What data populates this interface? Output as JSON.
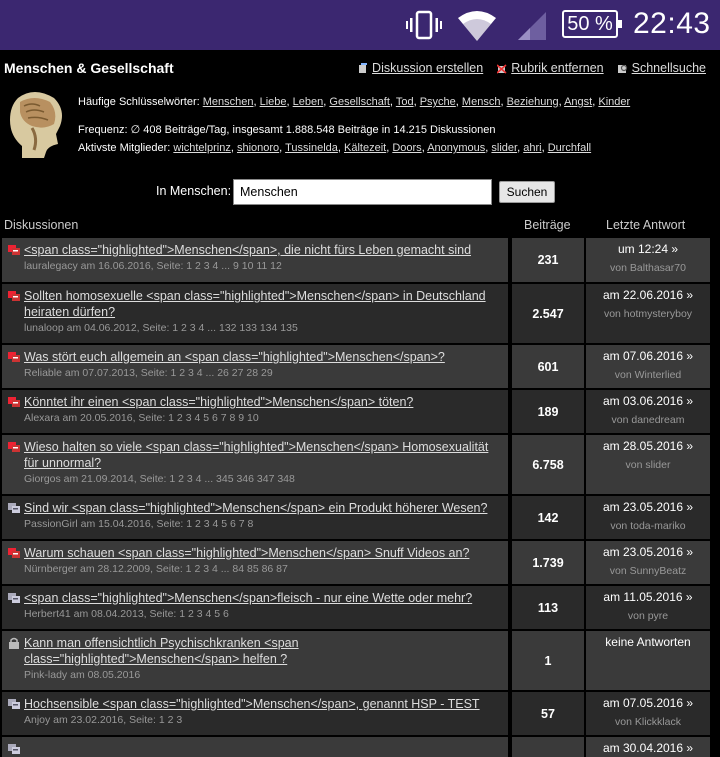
{
  "status_bar": {
    "battery": "50 %",
    "time": "22:43"
  },
  "header": {
    "title": "Menschen & Gesellschaft",
    "links": [
      "Diskussion erstellen",
      "Rubrik entfernen",
      "Schnellsuche"
    ]
  },
  "info": {
    "keywords_label": "Häufige Schlüsselwörter:",
    "keywords": [
      "Menschen",
      "Liebe",
      "Leben",
      "Gesellschaft",
      "Tod",
      "Psyche",
      "Mensch",
      "Beziehung",
      "Angst",
      "Kinder"
    ],
    "frequency": "Frequenz: ∅ 408 Beiträge/Tag, insgesamt 1.888.548 Beiträge in 14.215 Diskussionen",
    "members_label": "Aktivste Mitglieder:",
    "members": [
      "wichtelprinz",
      "shionoro",
      "Tussinelda",
      "Kältezeit",
      "Doors",
      "Anonymous",
      "slider",
      "ahri",
      "Durchfall"
    ]
  },
  "search": {
    "label": "In Menschen:",
    "value": "Menschen",
    "button": "Suchen"
  },
  "table": {
    "headers": [
      "Diskussionen",
      "Beiträge",
      "Letzte Antwort"
    ],
    "rows": [
      {
        "title": "<span class=\"highlighted\">Menschen</span>, die nicht fürs Leben gemacht sind",
        "meta": "lauralegacy am 16.06.2016, Seite: 1 2 3 4 ... 9 10 11 12",
        "count": "231",
        "last_date": "um 12:24 »",
        "last_by": "von Balthasar70",
        "icon": "hot-topic-icon"
      },
      {
        "title": "Sollten homosexuelle <span class=\"highlighted\">Menschen</span> in Deutschland heiraten dürfen?",
        "meta": "lunaloop am 04.06.2012, Seite: 1 2 3 4 ... 132 133 134 135",
        "count": "2.547",
        "last_date": "am 22.06.2016 »",
        "last_by": "von hotmysteryboy",
        "icon": "hot-topic-icon"
      },
      {
        "title": "Was stört euch allgemein an <span class=\"highlighted\">Menschen</span>?",
        "meta": "Reliable am 07.07.2013, Seite: 1 2 3 4 ... 26 27 28 29",
        "count": "601",
        "last_date": "am 07.06.2016 »",
        "last_by": "von Winterlied",
        "icon": "hot-topic-icon"
      },
      {
        "title": "Könntet ihr einen <span class=\"highlighted\">Menschen</span> töten?",
        "meta": "Alexara am 20.05.2016, Seite: 1 2 3 4 5 6 7 8 9 10",
        "count": "189",
        "last_date": "am 03.06.2016 »",
        "last_by": "von danedream",
        "icon": "hot-topic-icon"
      },
      {
        "title": "Wieso halten so viele <span class=\"highlighted\">Menschen</span> Homosexualität für unnormal?",
        "meta": "Giorgos am 21.09.2014, Seite: 1 2 3 4 ... 345 346 347 348",
        "count": "6.758",
        "last_date": "am 28.05.2016 »",
        "last_by": "von slider",
        "icon": "hot-topic-icon"
      },
      {
        "title": "Sind wir <span class=\"highlighted\">Menschen</span> ein Produkt höherer Wesen?",
        "meta": "PassionGirl am 15.04.2016, Seite: 1 2 3 4 5 6 7 8",
        "count": "142",
        "last_date": "am 23.05.2016 »",
        "last_by": "von toda-mariko",
        "icon": "topic-icon"
      },
      {
        "title": "Warum schauen <span class=\"highlighted\">Menschen</span> Snuff Videos an?",
        "meta": "Nürnberger am 28.12.2009, Seite: 1 2 3 4 ... 84 85 86 87",
        "count": "1.739",
        "last_date": "am 23.05.2016 »",
        "last_by": "von SunnyBeatz",
        "icon": "hot-topic-icon"
      },
      {
        "title": "<span class=\"highlighted\">Menschen</span>fleisch - nur eine Wette oder mehr?",
        "meta": "Herbert41 am 08.04.2013, Seite: 1 2 3 4 5 6",
        "count": "113",
        "last_date": "am 11.05.2016 »",
        "last_by": "von pyre",
        "icon": "topic-icon"
      },
      {
        "title": "Kann man offensichtlich Psychischkranken <span class=\"highlighted\">Menschen</span> helfen ?",
        "meta": "Pink-lady am 08.05.2016",
        "count": "1",
        "last_date": "keine Antworten",
        "last_by": "",
        "icon": "locked-topic-icon"
      },
      {
        "title": "Hochsensible <span class=\"highlighted\">Menschen</span>, genannt HSP - TEST",
        "meta": "Anjoy am 23.02.2016, Seite: 1 2 3",
        "count": "57",
        "last_date": "am 07.05.2016 »",
        "last_by": "von Klickklack",
        "icon": "topic-icon"
      },
      {
        "title": "",
        "meta": "",
        "count": "",
        "last_date": "am 30.04.2016 »",
        "last_by": "",
        "icon": "topic-icon"
      }
    ]
  }
}
